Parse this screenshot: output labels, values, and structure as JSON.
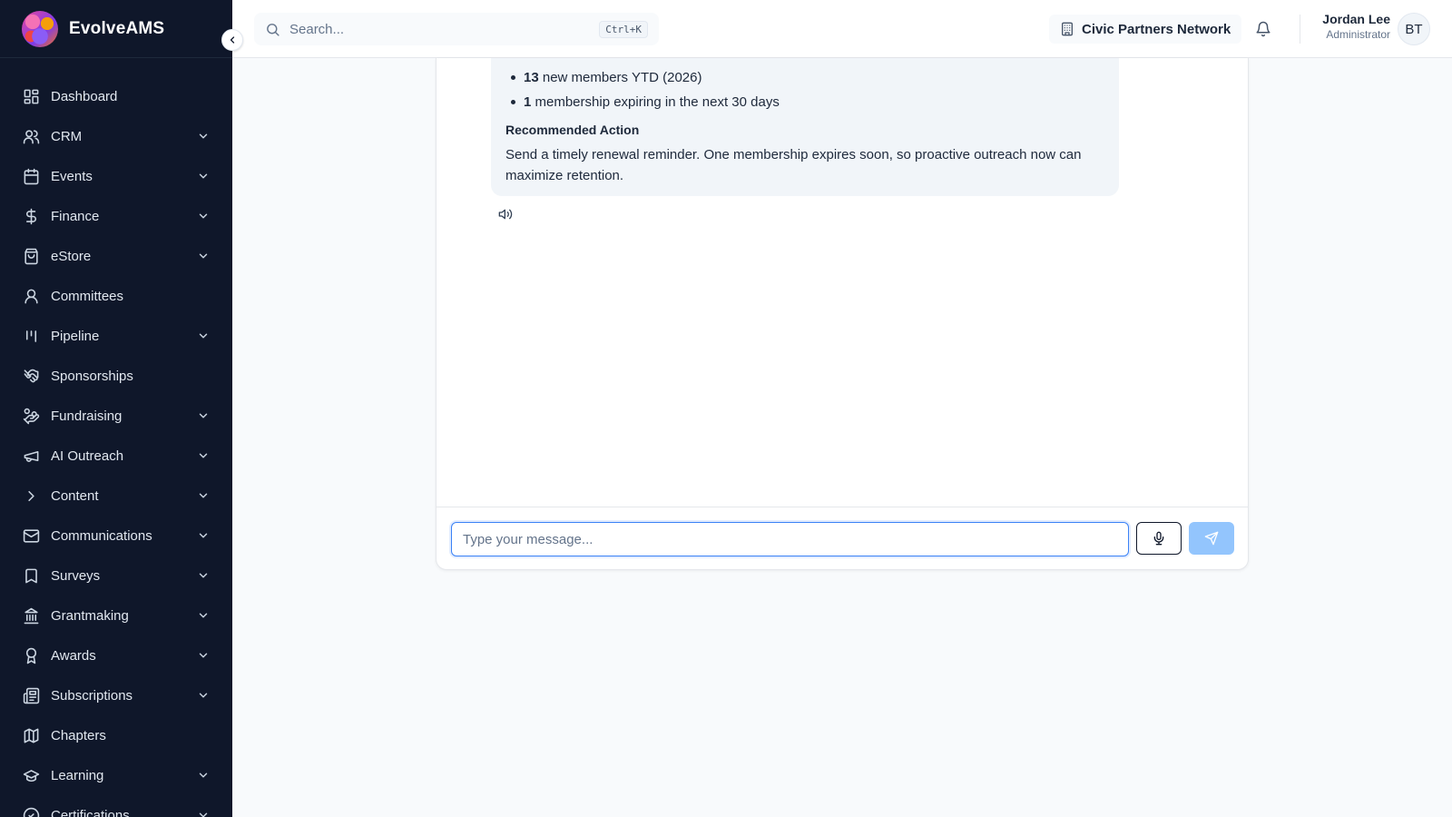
{
  "app": {
    "name": "EvolveAMS"
  },
  "sidebar": {
    "items": [
      {
        "label": "Dashboard",
        "icon": "grid-icon",
        "expandable": false
      },
      {
        "label": "CRM",
        "icon": "users-icon",
        "expandable": true
      },
      {
        "label": "Events",
        "icon": "calendar-icon",
        "expandable": true
      },
      {
        "label": "Finance",
        "icon": "dollar-icon",
        "expandable": true
      },
      {
        "label": "eStore",
        "icon": "shopping-bag-icon",
        "expandable": true
      },
      {
        "label": "Committees",
        "icon": "user-group-icon",
        "expandable": false
      },
      {
        "label": "Pipeline",
        "icon": "kanban-icon",
        "expandable": true
      },
      {
        "label": "Sponsorships",
        "icon": "handshake-icon",
        "expandable": false
      },
      {
        "label": "Fundraising",
        "icon": "hand-coins-icon",
        "expandable": true
      },
      {
        "label": "AI Outreach",
        "icon": "megaphone-icon",
        "expandable": true
      },
      {
        "label": "Content",
        "icon": "chevron-right-icon",
        "expandable": true
      },
      {
        "label": "Communications",
        "icon": "mail-icon",
        "expandable": true
      },
      {
        "label": "Surveys",
        "icon": "bookmark-icon",
        "expandable": true
      },
      {
        "label": "Grantmaking",
        "icon": "landmark-icon",
        "expandable": true
      },
      {
        "label": "Awards",
        "icon": "award-icon",
        "expandable": true
      },
      {
        "label": "Subscriptions",
        "icon": "newspaper-icon",
        "expandable": true
      },
      {
        "label": "Chapters",
        "icon": "map-icon",
        "expandable": false
      },
      {
        "label": "Learning",
        "icon": "graduation-cap-icon",
        "expandable": true
      },
      {
        "label": "Certifications",
        "icon": "check-circle-icon",
        "expandable": true
      }
    ]
  },
  "header": {
    "search_placeholder": "Search...",
    "search_shortcut": "Ctrl+K",
    "organization": "Civic Partners Network",
    "user_name": "Jordan Lee",
    "user_role": "Administrator",
    "avatar_initials": "BT"
  },
  "chat": {
    "message": {
      "bullets": [
        {
          "value": "13",
          "text": " new members YTD (2026)"
        },
        {
          "value": "1",
          "text": " membership expiring in the next 30 days"
        }
      ],
      "recommended_title": "Recommended Action",
      "recommended_text": "Send a timely renewal reminder. One membership expires soon, so proactive outreach now can maximize retention."
    },
    "input_placeholder": "Type your message..."
  },
  "colors": {
    "sidebar_bg": "#0f172a",
    "accent": "#3b82f6",
    "send_button": "#93c5fd",
    "bubble_bg": "#f1f5f9"
  }
}
